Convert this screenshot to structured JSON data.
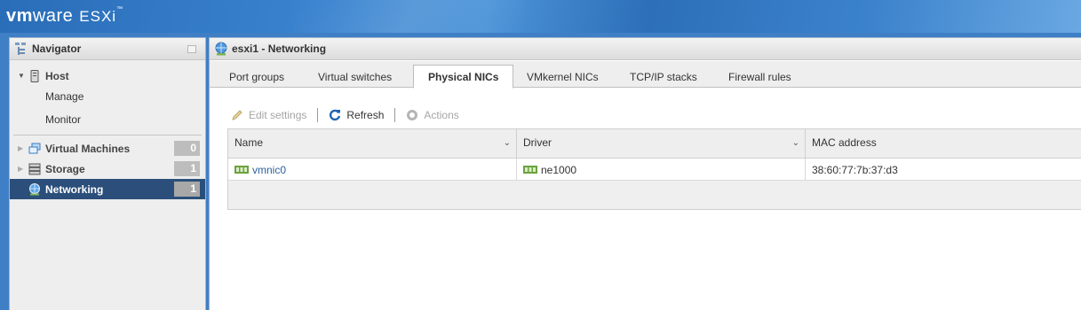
{
  "header": {
    "brand_vm": "vm",
    "brand_ware": "ware",
    "brand_product": "ESXi",
    "brand_tm": "™",
    "bg_color": "#3f7fc5"
  },
  "navigator": {
    "title": "Navigator",
    "host": {
      "label": "Host",
      "children": [
        "Manage",
        "Monitor"
      ]
    },
    "items": [
      {
        "label": "Virtual Machines",
        "count": "0",
        "icon": "vm-icon"
      },
      {
        "label": "Storage",
        "count": "1",
        "icon": "storage-icon"
      },
      {
        "label": "Networking",
        "count": "1",
        "icon": "networking-icon",
        "active": true
      }
    ],
    "active_color": "#2b4f7a"
  },
  "main": {
    "title": "esxi1 - Networking",
    "tabs": [
      {
        "label": "Port groups"
      },
      {
        "label": "Virtual switches"
      },
      {
        "label": "Physical NICs",
        "active": true
      },
      {
        "label": "VMkernel NICs"
      },
      {
        "label": "TCP/IP stacks"
      },
      {
        "label": "Firewall rules"
      }
    ],
    "toolbar": {
      "edit_settings": "Edit settings",
      "refresh": "Refresh",
      "actions": "Actions"
    },
    "table": {
      "columns": [
        "Name",
        "Driver",
        "MAC address"
      ],
      "rows": [
        {
          "name": "vmnic0",
          "driver": "ne1000",
          "mac": "38:60:77:7b:37:d3"
        }
      ]
    }
  }
}
